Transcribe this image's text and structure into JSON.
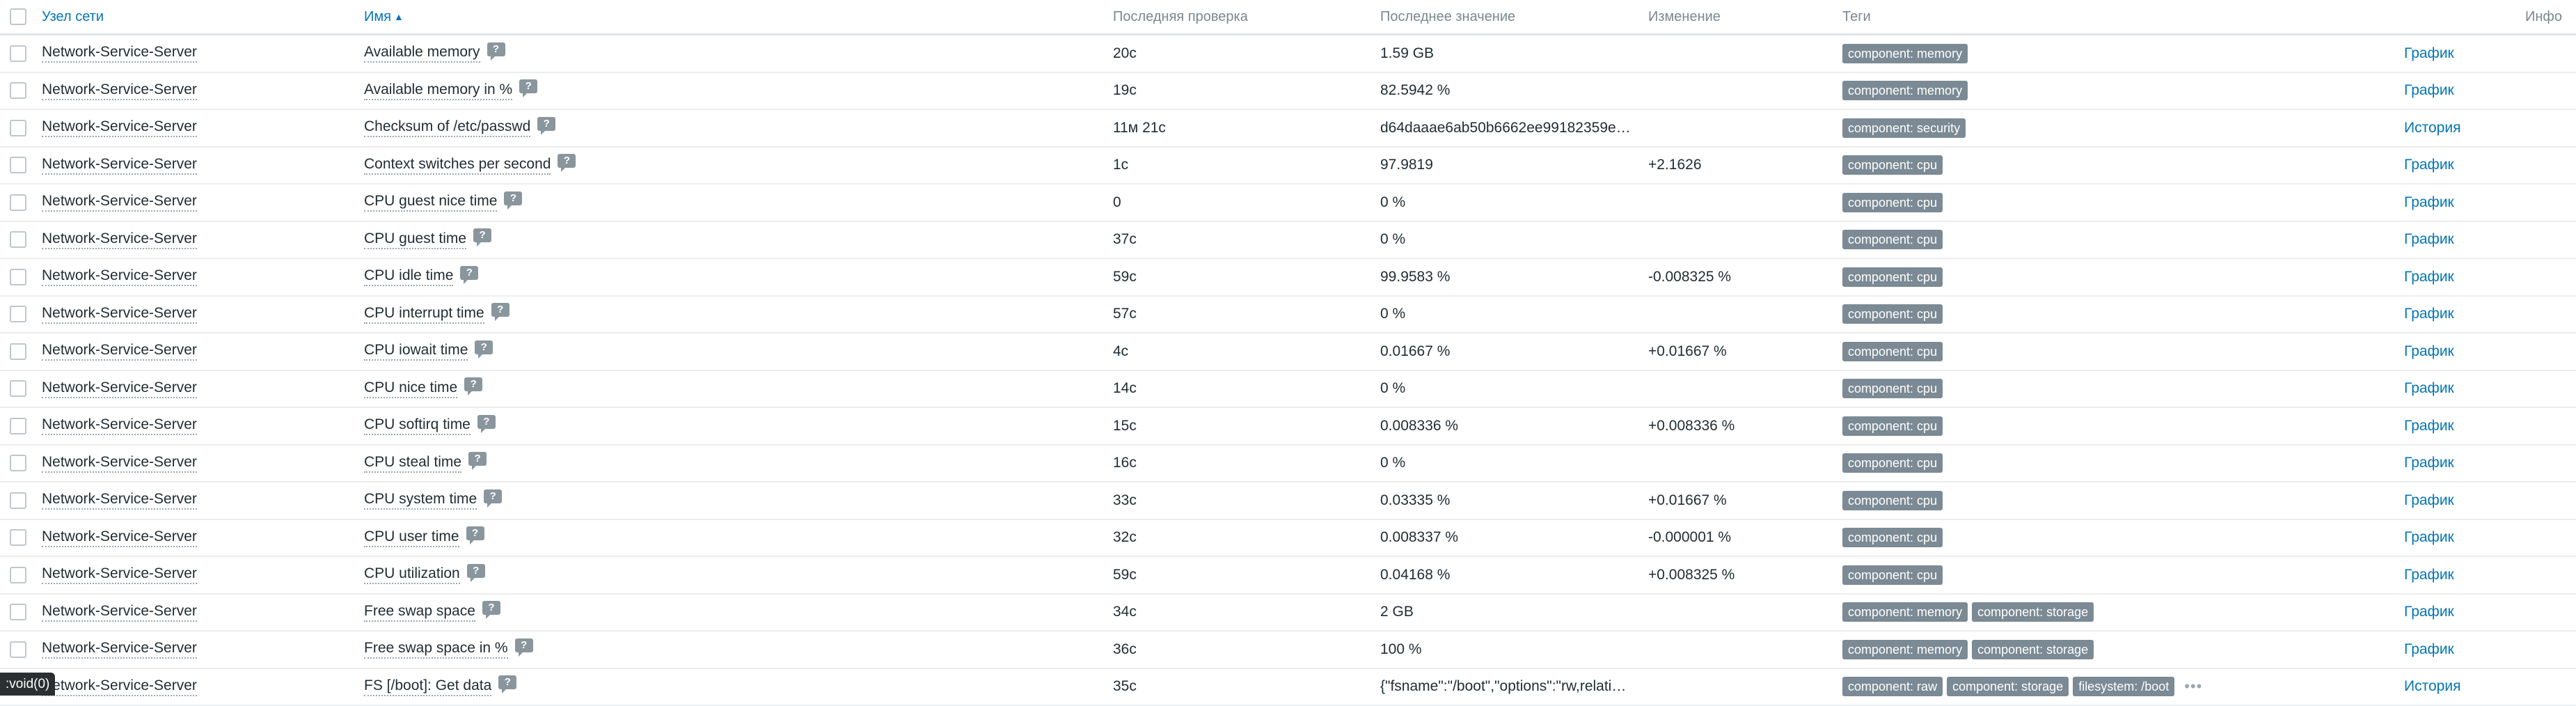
{
  "header": {
    "host": "Узел сети",
    "name": "Имя",
    "sort_indicator": "▲",
    "last_check": "Последняя проверка",
    "last_value": "Последнее значение",
    "change": "Изменение",
    "tags": "Теги",
    "info": "Инфо"
  },
  "help_glyph": "?",
  "rows": [
    {
      "host": "Network-Service-Server",
      "name": "Available memory",
      "last_check": "20с",
      "last_value": "1.59 GB",
      "change": "",
      "tags": [
        "component: memory"
      ],
      "action": "График"
    },
    {
      "host": "Network-Service-Server",
      "name": "Available memory in %",
      "last_check": "19с",
      "last_value": "82.5942 %",
      "change": "",
      "tags": [
        "component: memory"
      ],
      "action": "График"
    },
    {
      "host": "Network-Service-Server",
      "name": "Checksum of /etc/passwd",
      "last_check": "11м 21с",
      "last_value": "d64daaae6ab50b6662ee99182359e…",
      "change": "",
      "tags": [
        "component: security"
      ],
      "action": "История"
    },
    {
      "host": "Network-Service-Server",
      "name": "Context switches per second",
      "last_check": "1с",
      "last_value": "97.9819",
      "change": "+2.1626",
      "tags": [
        "component: cpu"
      ],
      "action": "График"
    },
    {
      "host": "Network-Service-Server",
      "name": "CPU guest nice time",
      "last_check": "0",
      "last_value": "0 %",
      "change": "",
      "tags": [
        "component: cpu"
      ],
      "action": "График"
    },
    {
      "host": "Network-Service-Server",
      "name": "CPU guest time",
      "last_check": "37с",
      "last_value": "0 %",
      "change": "",
      "tags": [
        "component: cpu"
      ],
      "action": "График"
    },
    {
      "host": "Network-Service-Server",
      "name": "CPU idle time",
      "last_check": "59с",
      "last_value": "99.9583 %",
      "change": "-0.008325 %",
      "tags": [
        "component: cpu"
      ],
      "action": "График"
    },
    {
      "host": "Network-Service-Server",
      "name": "CPU interrupt time",
      "last_check": "57с",
      "last_value": "0 %",
      "change": "",
      "tags": [
        "component: cpu"
      ],
      "action": "График"
    },
    {
      "host": "Network-Service-Server",
      "name": "CPU iowait time",
      "last_check": "4с",
      "last_value": "0.01667 %",
      "change": "+0.01667 %",
      "tags": [
        "component: cpu"
      ],
      "action": "График"
    },
    {
      "host": "Network-Service-Server",
      "name": "CPU nice time",
      "last_check": "14с",
      "last_value": "0 %",
      "change": "",
      "tags": [
        "component: cpu"
      ],
      "action": "График"
    },
    {
      "host": "Network-Service-Server",
      "name": "CPU softirq time",
      "last_check": "15с",
      "last_value": "0.008336 %",
      "change": "+0.008336 %",
      "tags": [
        "component: cpu"
      ],
      "action": "График"
    },
    {
      "host": "Network-Service-Server",
      "name": "CPU steal time",
      "last_check": "16с",
      "last_value": "0 %",
      "change": "",
      "tags": [
        "component: cpu"
      ],
      "action": "График"
    },
    {
      "host": "Network-Service-Server",
      "name": "CPU system time",
      "last_check": "33с",
      "last_value": "0.03335 %",
      "change": "+0.01667 %",
      "tags": [
        "component: cpu"
      ],
      "action": "График"
    },
    {
      "host": "Network-Service-Server",
      "name": "CPU user time",
      "last_check": "32с",
      "last_value": "0.008337 %",
      "change": "-0.000001 %",
      "tags": [
        "component: cpu"
      ],
      "action": "График"
    },
    {
      "host": "Network-Service-Server",
      "name": "CPU utilization",
      "last_check": "59с",
      "last_value": "0.04168 %",
      "change": "+0.008325 %",
      "tags": [
        "component: cpu"
      ],
      "action": "График"
    },
    {
      "host": "Network-Service-Server",
      "name": "Free swap space",
      "last_check": "34с",
      "last_value": "2 GB",
      "change": "",
      "tags": [
        "component: memory",
        "component: storage"
      ],
      "action": "График"
    },
    {
      "host": "Network-Service-Server",
      "name": "Free swap space in %",
      "last_check": "36с",
      "last_value": "100 %",
      "change": "",
      "tags": [
        "component: memory",
        "component: storage"
      ],
      "action": "График"
    },
    {
      "host": "Network-Service-Server",
      "name": "FS [/boot]: Get data",
      "last_check": "35с",
      "last_value": "{\"fsname\":\"/boot\",\"options\":\"rw,relati…",
      "change": "",
      "tags": [
        "component: raw",
        "component: storage",
        "filesystem: /boot"
      ],
      "more": "•••",
      "action": "История"
    }
  ],
  "status_bar_text": ":void(0)",
  "colors": {
    "link_blue": "#0275b8",
    "tag_bg": "#7b8a94",
    "row_border": "#ebeef0"
  }
}
